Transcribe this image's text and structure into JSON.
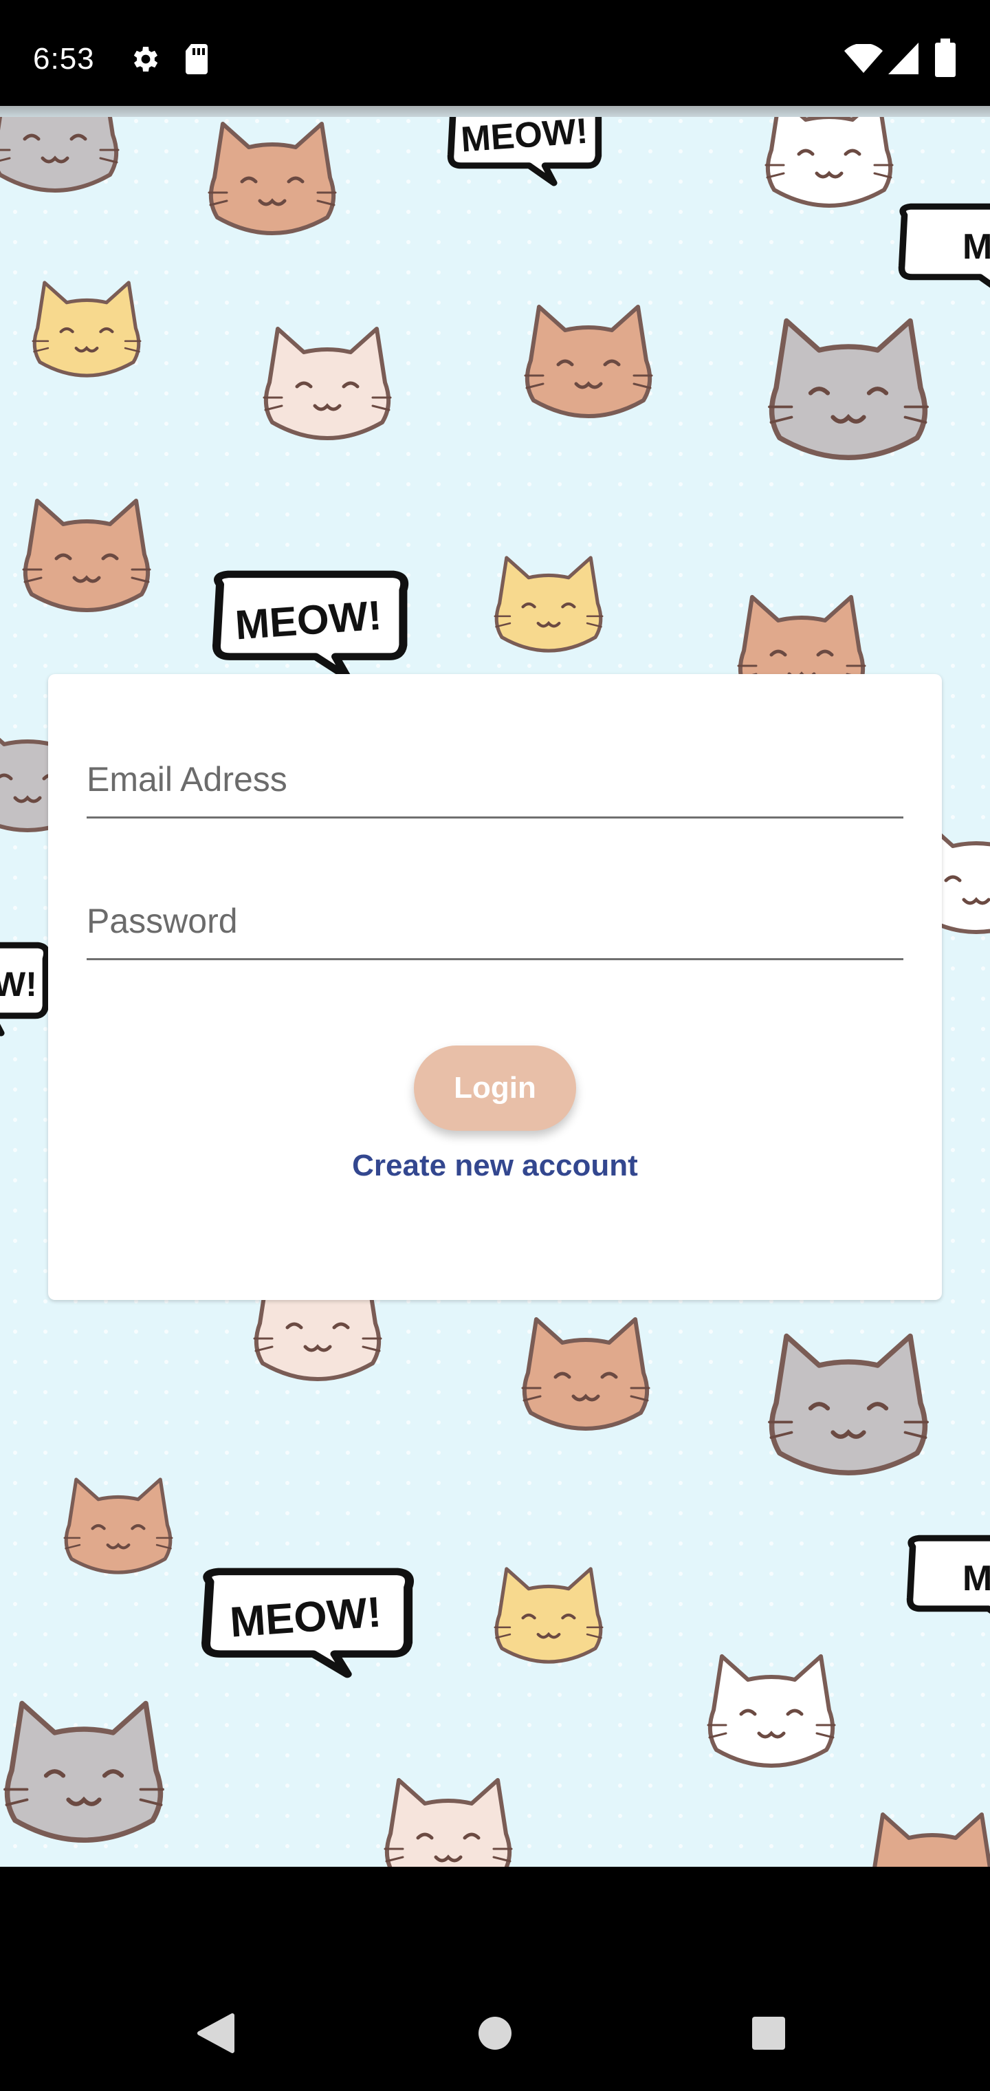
{
  "status_bar": {
    "time": "6:53",
    "icons": [
      "gear-icon",
      "sd-card-icon",
      "wifi-icon",
      "signal-icon",
      "battery-icon"
    ]
  },
  "background": {
    "color": "#e3f6fb",
    "pattern": "cat-faces",
    "speech_bubbles": [
      "MEOW!",
      "MEOW!",
      "MEOW!",
      "W!",
      "ME",
      "ME"
    ]
  },
  "login_form": {
    "email_placeholder": "Email Adress",
    "password_placeholder": "Password",
    "login_button_label": "Login",
    "create_account_link": "Create new account"
  },
  "colors": {
    "login_button": "#e8bfa8",
    "link": "#33478f",
    "field_underline": "#6f6f6f",
    "cat_orange": "#e0a98c",
    "cat_grey": "#c4c1c3",
    "cat_yellow": "#f7d98e",
    "cat_cream": "#f6e4dc",
    "cat_white": "#ffffff"
  },
  "nav_bar": {
    "buttons": [
      "back-icon",
      "home-icon",
      "recents-icon"
    ]
  }
}
